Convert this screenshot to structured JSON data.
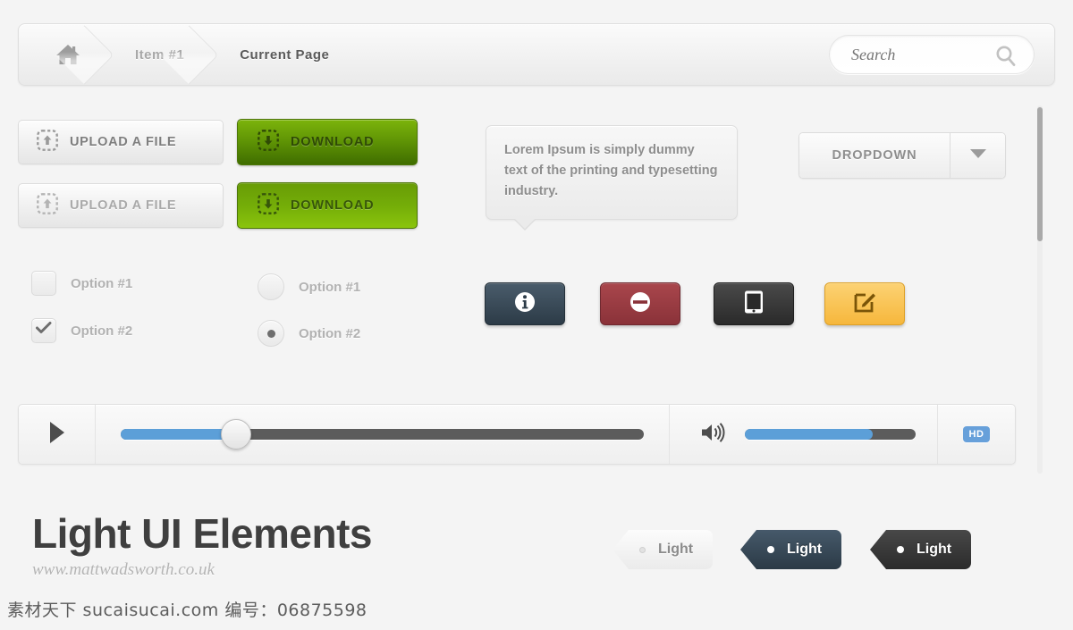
{
  "breadcrumb": {
    "home_icon": "home-icon",
    "items": [
      {
        "label": "Item #1"
      },
      {
        "label": "Current Page"
      }
    ]
  },
  "search": {
    "placeholder": "Search",
    "value": "",
    "icon": "search-icon"
  },
  "buttons": {
    "upload_1": "UPLOAD A FILE",
    "upload_2": "UPLOAD A FILE",
    "download_1": "DOWNLOAD",
    "download_2": "DOWNLOAD",
    "upload_icon": "upload-icon",
    "download_icon": "download-icon"
  },
  "tooltip": {
    "text": "Lorem Ipsum is simply dummy text of the printing and typesetting industry."
  },
  "dropdown": {
    "label": "DROPDOWN",
    "caret_icon": "chevron-down-icon"
  },
  "checkboxes": [
    {
      "label": "Option #1",
      "checked": false
    },
    {
      "label": "Option #2",
      "checked": true
    }
  ],
  "radios": [
    {
      "label": "Option #1",
      "selected": false
    },
    {
      "label": "Option #2",
      "selected": true
    }
  ],
  "icon_buttons": [
    {
      "name": "info-button",
      "icon": "info-icon",
      "color": "#2c3b47"
    },
    {
      "name": "block-button",
      "icon": "no-entry-icon",
      "color": "#8a3239"
    },
    {
      "name": "tablet-button",
      "icon": "tablet-icon",
      "color": "#2a2a2a"
    },
    {
      "name": "edit-button",
      "icon": "edit-icon",
      "color": "#f6b73c"
    }
  ],
  "player": {
    "play_icon": "play-icon",
    "volume_icon": "volume-icon",
    "progress_percent": 22,
    "volume_percent": 75,
    "hd_label": "HD",
    "accent_color": "#5c9fd8",
    "track_color": "#5c5c5c"
  },
  "footer": {
    "title": "Light UI Elements",
    "subtitle": "www.mattwadsworth.co.uk"
  },
  "tags": [
    {
      "label": "Light",
      "style": "light"
    },
    {
      "label": "Light",
      "style": "blue"
    },
    {
      "label": "Light",
      "style": "dark"
    }
  ],
  "watermark": {
    "text": "素材天下 sucaisucai.com  编号：06875598"
  }
}
